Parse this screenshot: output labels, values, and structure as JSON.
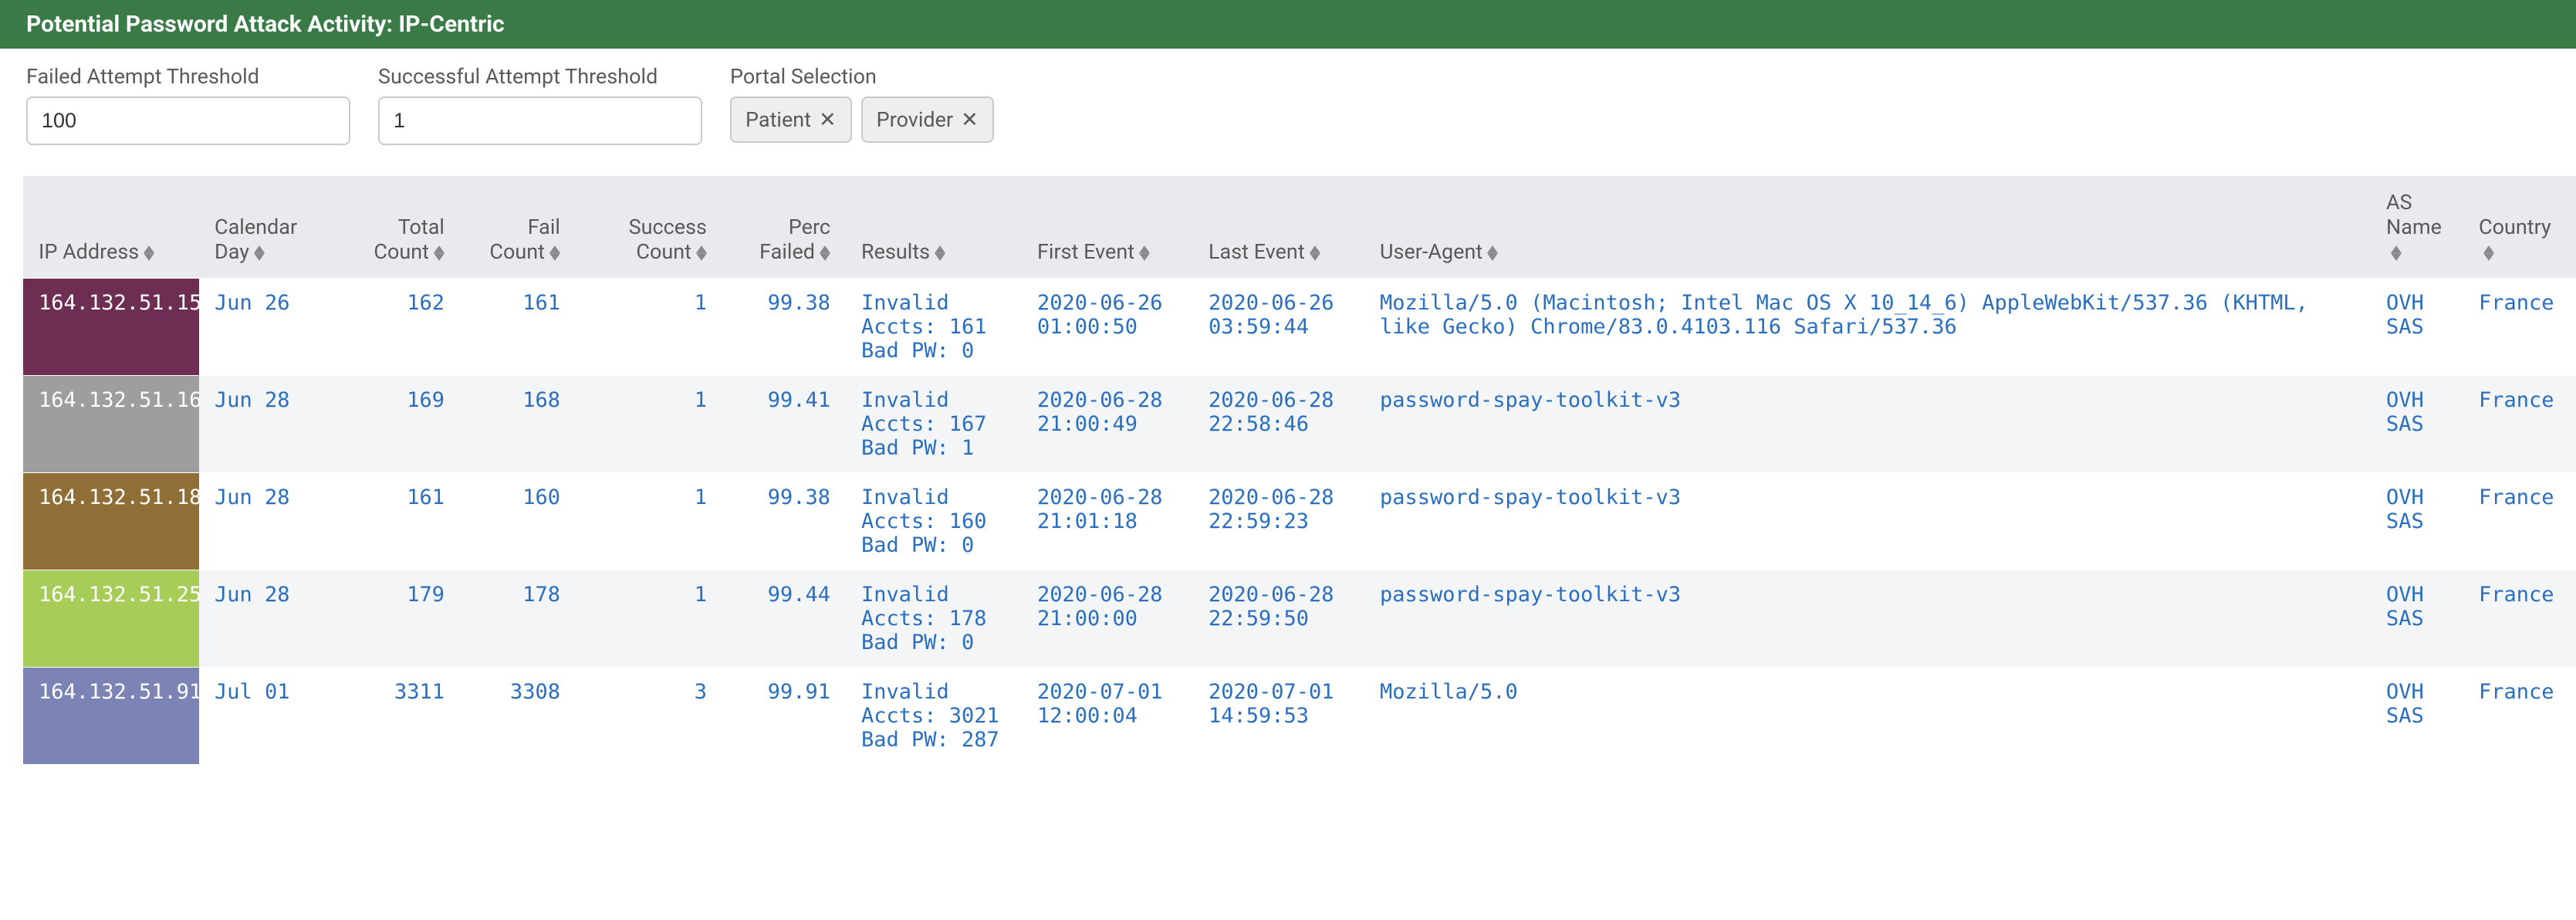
{
  "panel": {
    "title": "Potential Password Attack Activity: IP-Centric"
  },
  "filters": {
    "failed_label": "Failed Attempt Threshold",
    "failed_value": "100",
    "success_label": "Successful Attempt Threshold",
    "success_value": "1",
    "portal_label": "Portal Selection",
    "portal_chips": [
      "Patient",
      "Provider"
    ]
  },
  "columns": [
    {
      "key": "ip",
      "label": "IP Address",
      "align": "left"
    },
    {
      "key": "day",
      "label": "Calendar Day",
      "align": "left"
    },
    {
      "key": "total",
      "label": "Total Count",
      "align": "right"
    },
    {
      "key": "fail",
      "label": "Fail Count",
      "align": "right"
    },
    {
      "key": "succ",
      "label": "Success Count",
      "align": "right"
    },
    {
      "key": "perc",
      "label": "Perc Failed",
      "align": "right"
    },
    {
      "key": "res",
      "label": "Results",
      "align": "left"
    },
    {
      "key": "first",
      "label": "First Event",
      "align": "left"
    },
    {
      "key": "last",
      "label": "Last Event",
      "align": "left"
    },
    {
      "key": "ua",
      "label": "User-Agent",
      "align": "left"
    },
    {
      "key": "as",
      "label": "AS Name",
      "align": "left"
    },
    {
      "key": "ctry",
      "label": "Country",
      "align": "left"
    }
  ],
  "rows": [
    {
      "ip": "164.132.51.15",
      "ip_color": "#6e2e54",
      "day": "Jun 26",
      "total": "162",
      "fail": "161",
      "succ": "1",
      "perc": "99.38",
      "res": "Invalid Accts: 161 Bad PW: 0",
      "first": "2020-06-26 01:00:50",
      "last": "2020-06-26 03:59:44",
      "ua": "Mozilla/5.0 (Macintosh; Intel Mac OS X 10_14_6) AppleWebKit/537.36 (KHTML, like Gecko) Chrome/83.0.4103.116 Safari/537.36",
      "as": "OVH SAS",
      "ctry": "France"
    },
    {
      "ip": "164.132.51.16",
      "ip_color": "#9e9e9e",
      "day": "Jun 28",
      "total": "169",
      "fail": "168",
      "succ": "1",
      "perc": "99.41",
      "res": "Invalid Accts: 167 Bad PW: 1",
      "first": "2020-06-28 21:00:49",
      "last": "2020-06-28 22:58:46",
      "ua": "password-spay-toolkit-v3",
      "as": "OVH SAS",
      "ctry": "France"
    },
    {
      "ip": "164.132.51.18",
      "ip_color": "#8f6f35",
      "day": "Jun 28",
      "total": "161",
      "fail": "160",
      "succ": "1",
      "perc": "99.38",
      "res": "Invalid Accts: 160 Bad PW: 0",
      "first": "2020-06-28 21:01:18",
      "last": "2020-06-28 22:59:23",
      "ua": "password-spay-toolkit-v3",
      "as": "OVH SAS",
      "ctry": "France"
    },
    {
      "ip": "164.132.51.25",
      "ip_color": "#a7cd58",
      "day": "Jun 28",
      "total": "179",
      "fail": "178",
      "succ": "1",
      "perc": "99.44",
      "res": "Invalid Accts: 178 Bad PW: 0",
      "first": "2020-06-28 21:00:00",
      "last": "2020-06-28 22:59:50",
      "ua": "password-spay-toolkit-v3",
      "as": "OVH SAS",
      "ctry": "France"
    },
    {
      "ip": "164.132.51.91",
      "ip_color": "#7b84b5",
      "day": "Jul 01",
      "total": "3311",
      "fail": "3308",
      "succ": "3",
      "perc": "99.91",
      "res": "Invalid Accts: 3021 Bad PW: 287",
      "first": "2020-07-01 12:00:04",
      "last": "2020-07-01 14:59:53",
      "ua": "Mozilla/5.0",
      "as": "OVH SAS",
      "ctry": "France"
    }
  ]
}
